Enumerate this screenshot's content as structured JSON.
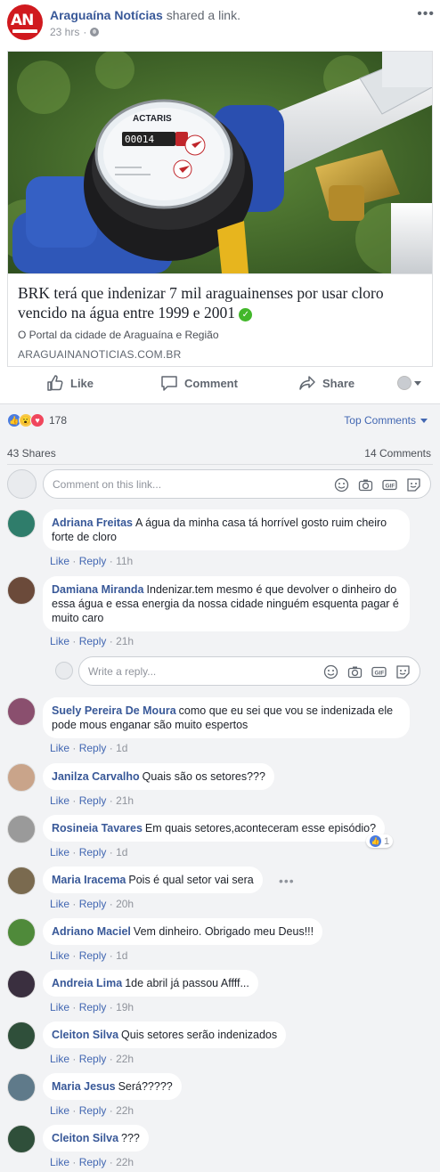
{
  "post": {
    "page_name": "Araguaína Notícias",
    "action_text": "shared a link.",
    "time": "23 hrs",
    "logo_text": "AN"
  },
  "link": {
    "title": "BRK terá que indenizar 7 mil araguainenses por usar cloro vencido na água entre 1999 e 2001",
    "description": "O Portal da cidade de Araguaína e Região",
    "domain": "ARAGUAINANOTICIAS.COM.BR",
    "meter_brand": "ACTARIS"
  },
  "actions": {
    "like": "Like",
    "comment": "Comment",
    "share": "Share"
  },
  "stats": {
    "reaction_count": "178",
    "sort_label": "Top Comments",
    "shares": "43 Shares",
    "comments": "14 Comments"
  },
  "composer": {
    "placeholder": "Comment on this link...",
    "reply_placeholder": "Write a reply...",
    "gif_label": "GIF"
  },
  "labels": {
    "like": "Like",
    "reply": "Reply",
    "sep": "·"
  },
  "comments": [
    {
      "author": "Adriana Freitas",
      "text": "A água da minha casa tá horrível gosto ruim cheiro forte de cloro",
      "time": "11h",
      "avatar_color": "#2f7d6b"
    },
    {
      "author": "Damiana Miranda",
      "text": "Indenizar.tem mesmo é que devolver o dinheiro do essa água e essa energia da nossa cidade ninguém esquenta pagar é muito caro",
      "time": "21h",
      "avatar_color": "#6b4a3a"
    },
    {
      "author": "Suely Pereira De Moura",
      "text": "como que eu sei que vou se indenizada ele pode mous enganar são muito espertos",
      "time": "1d",
      "avatar_color": "#8a4f6e"
    },
    {
      "author": "Janilza Carvalho",
      "text": "Quais são os setores???",
      "time": "21h",
      "avatar_color": "#c9a48a"
    },
    {
      "author": "Rosineia Tavares",
      "text": "Em quais setores,aconteceram esse episódio?",
      "time": "1d",
      "avatar_color": "#9a9a9a",
      "reactions": "1"
    },
    {
      "author": "Maria Iracema",
      "text": "Pois é qual setor vai sera",
      "time": "20h",
      "avatar_color": "#7a6a4f"
    },
    {
      "author": "Adriano Maciel",
      "text": "Vem dinheiro. Obrigado meu Deus!!!",
      "time": "1d",
      "avatar_color": "#4f8a3a"
    },
    {
      "author": "Andreia Lima",
      "text": "1de abril já passou Affff...",
      "time": "19h",
      "avatar_color": "#3a2f3f"
    },
    {
      "author": "Cleiton Silva",
      "text": "Quis setores serão indenizados",
      "time": "22h",
      "avatar_color": "#2f4f3a"
    },
    {
      "author": "Maria Jesus",
      "text": "Será?????",
      "time": "22h",
      "avatar_color": "#5f7a8a"
    },
    {
      "author": "Cleiton Silva",
      "text": "???",
      "time": "22h",
      "avatar_color": "#2f4f3a"
    }
  ]
}
